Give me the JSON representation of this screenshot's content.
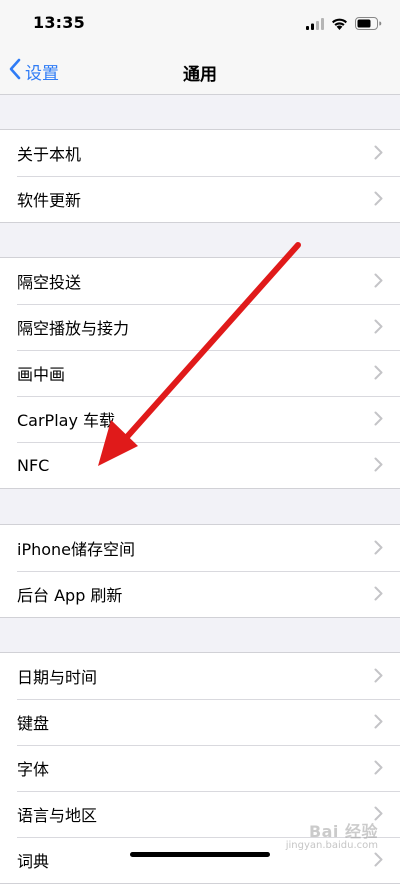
{
  "status_bar": {
    "time": "13:35",
    "icons": [
      "cellular-signal-icon",
      "wifi-icon",
      "battery-icon"
    ]
  },
  "nav": {
    "back_label": "设置",
    "title": "通用",
    "accent_color": "#2f7cf6"
  },
  "groups": [
    {
      "items": [
        "关于本机",
        "软件更新"
      ]
    },
    {
      "items": [
        "隔空投送",
        "隔空播放与接力",
        "画中画",
        "CarPlay 车载",
        "NFC"
      ]
    },
    {
      "items": [
        "iPhone储存空间",
        "后台 App 刷新"
      ]
    },
    {
      "items": [
        "日期与时间",
        "键盘",
        "字体",
        "语言与地区",
        "词典"
      ]
    }
  ],
  "annotation": {
    "type": "red-arrow",
    "color": "#e01a1a",
    "points_to": "NFC"
  },
  "watermark": {
    "text": "Bai 经验",
    "sub": "jingyan.baidu.com"
  }
}
